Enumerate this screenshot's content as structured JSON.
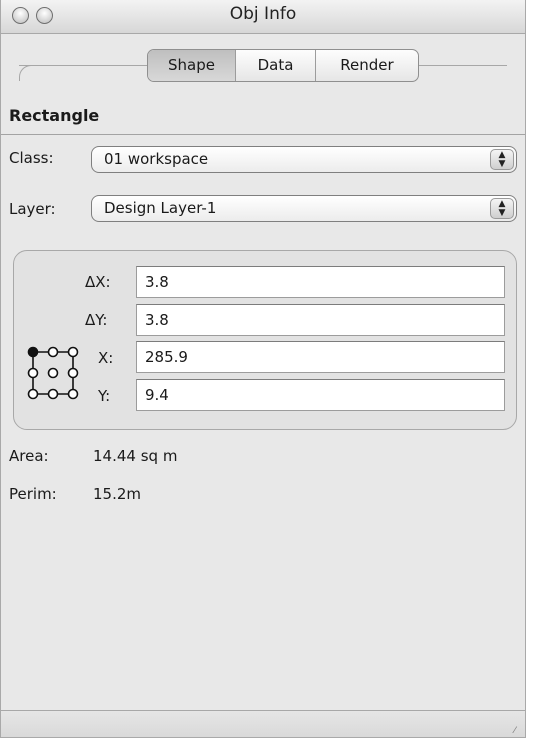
{
  "window": {
    "title": "Obj Info"
  },
  "tabs": [
    {
      "label": "Shape",
      "active": true
    },
    {
      "label": "Data",
      "active": false
    },
    {
      "label": "Render",
      "active": false
    }
  ],
  "object": {
    "type": "Rectangle"
  },
  "class_row": {
    "label": "Class:",
    "value": "01 workspace"
  },
  "layer_row": {
    "label": "Layer:",
    "value": "Design Layer-1"
  },
  "coords": {
    "dx": {
      "label": "ΔX:",
      "value": "3.8"
    },
    "dy": {
      "label": "ΔY:",
      "value": "3.8"
    },
    "x": {
      "label": "X:",
      "value": "285.9"
    },
    "y": {
      "label": "Y:",
      "value": "9.4"
    },
    "anchor_icon": "reference-point-grid-icon"
  },
  "info": {
    "area": {
      "label": "Area:",
      "value": "14.44 sq m"
    },
    "perim": {
      "label": "Perim:",
      "value": "15.2m"
    }
  },
  "icons": {
    "close": "close-icon",
    "minimize": "minimize-icon",
    "stepper": "stepper-arrows-icon",
    "resize": "resize-grip-icon"
  },
  "colors": {
    "window_bg": "#e8e8e8",
    "active_tab": "#c4c4c4",
    "field_bg": "#ffffff"
  }
}
